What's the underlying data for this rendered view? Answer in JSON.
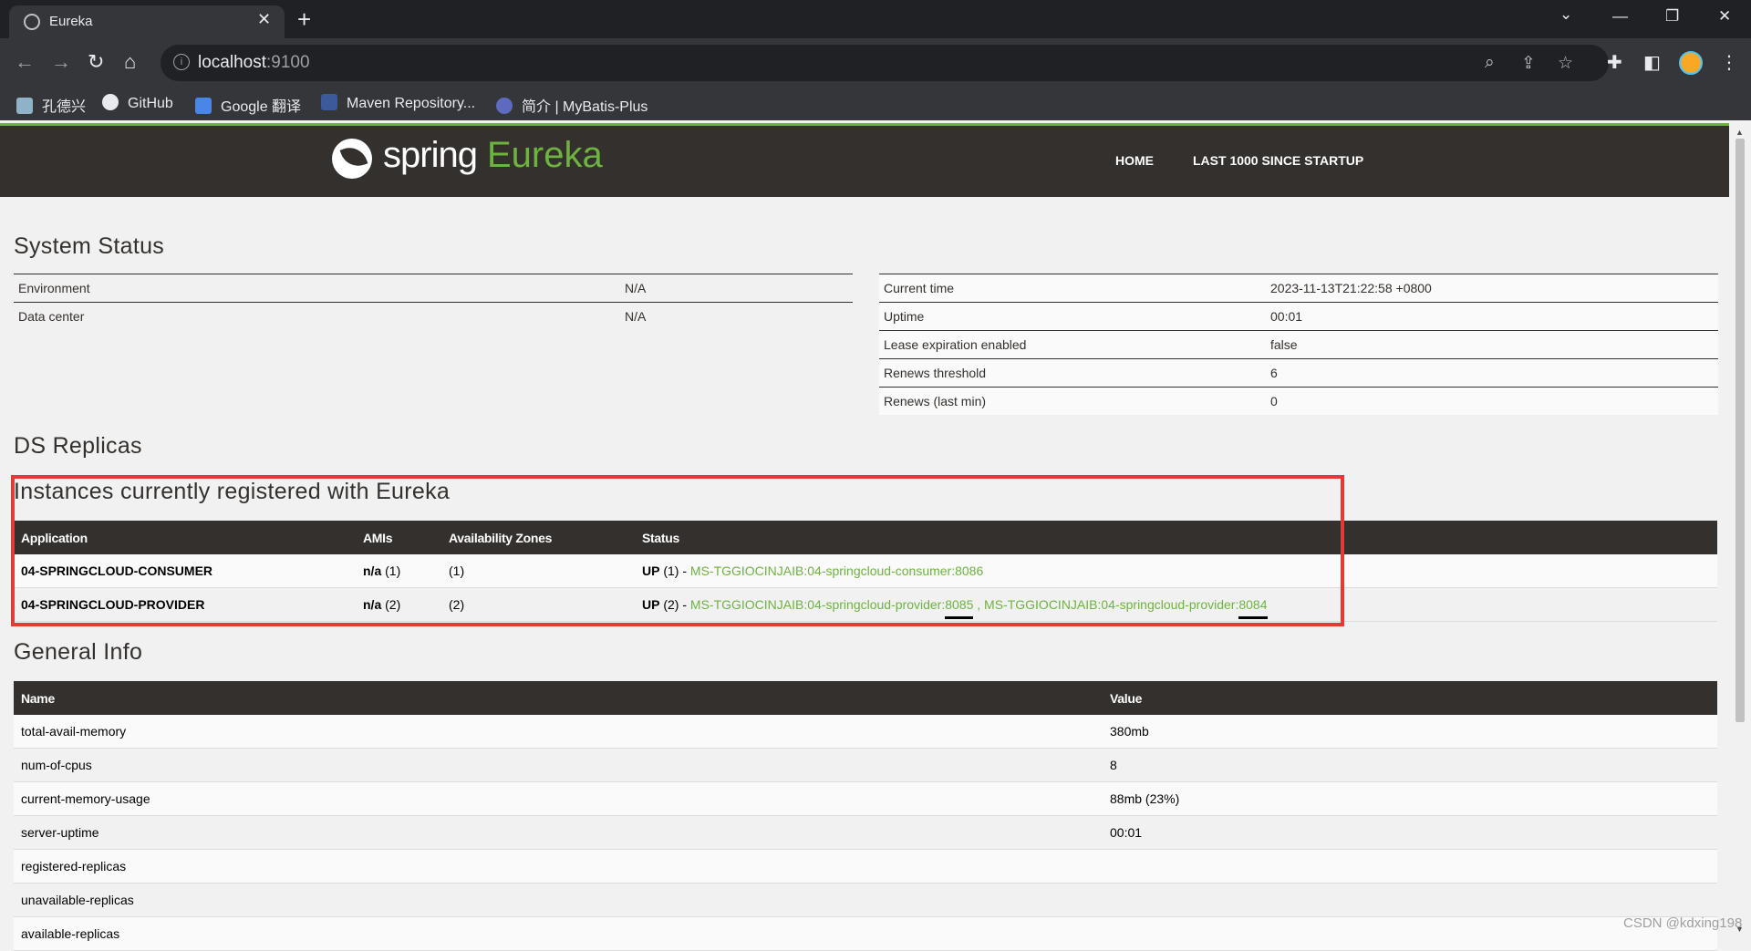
{
  "browser": {
    "tab_title": "Eureka",
    "tab_close": "✕",
    "new_tab": "+",
    "url_host": "localhost",
    "url_port": ":9100",
    "bookmarks": [
      "孔德兴",
      "GitHub",
      "Google 翻译",
      "Maven Repository...",
      "简介 | MyBatis-Plus"
    ]
  },
  "header": {
    "logo_spring": "spring",
    "logo_eureka": "Eureka",
    "nav": [
      "HOME",
      "LAST 1000 SINCE STARTUP"
    ]
  },
  "system_status": {
    "title": "System Status",
    "left": [
      {
        "label": "Environment",
        "value": "N/A"
      },
      {
        "label": "Data center",
        "value": "N/A"
      }
    ],
    "right": [
      {
        "label": "Current time",
        "value": "2023-11-13T21:22:58 +0800"
      },
      {
        "label": "Uptime",
        "value": "00:01"
      },
      {
        "label": "Lease expiration enabled",
        "value": "false"
      },
      {
        "label": "Renews threshold",
        "value": "6"
      },
      {
        "label": "Renews (last min)",
        "value": "0"
      }
    ]
  },
  "ds_replicas": {
    "title": "DS Replicas"
  },
  "instances": {
    "title": "Instances currently registered with Eureka",
    "headers": [
      "Application",
      "AMIs",
      "Availability Zones",
      "Status"
    ],
    "rows": [
      {
        "app": "04-SPRINGCLOUD-CONSUMER",
        "ami_bold": "n/a",
        "ami_count": " (1)",
        "zones": "(1)",
        "status_up": "UP",
        "status_count": " (1) - ",
        "link1_prefix": "MS-TGGIOCINJAIB:04-springcloud-consumer:",
        "link1_port": "8086"
      },
      {
        "app": "04-SPRINGCLOUD-PROVIDER",
        "ami_bold": "n/a",
        "ami_count": " (2)",
        "zones": "(2)",
        "status_up": "UP",
        "status_count": " (2) - ",
        "link1_prefix": "MS-TGGIOCINJAIB:04-springcloud-provider:",
        "link1_port": "8085",
        "separator": " , ",
        "link2_prefix": "MS-TGGIOCINJAIB:04-springcloud-provider:",
        "link2_port": "8084"
      }
    ]
  },
  "general_info": {
    "title": "General Info",
    "headers": [
      "Name",
      "Value"
    ],
    "rows": [
      {
        "name": "total-avail-memory",
        "value": "380mb"
      },
      {
        "name": "num-of-cpus",
        "value": "8"
      },
      {
        "name": "current-memory-usage",
        "value": "88mb (23%)"
      },
      {
        "name": "server-uptime",
        "value": "00:01"
      },
      {
        "name": "registered-replicas",
        "value": ""
      },
      {
        "name": "unavailable-replicas",
        "value": ""
      },
      {
        "name": "available-replicas",
        "value": ""
      }
    ]
  },
  "watermark": "CSDN @kdxing198",
  "colors": {
    "brand_dark": "#34302d",
    "brand_green": "#6db33f",
    "highlight_red": "#e53935"
  }
}
